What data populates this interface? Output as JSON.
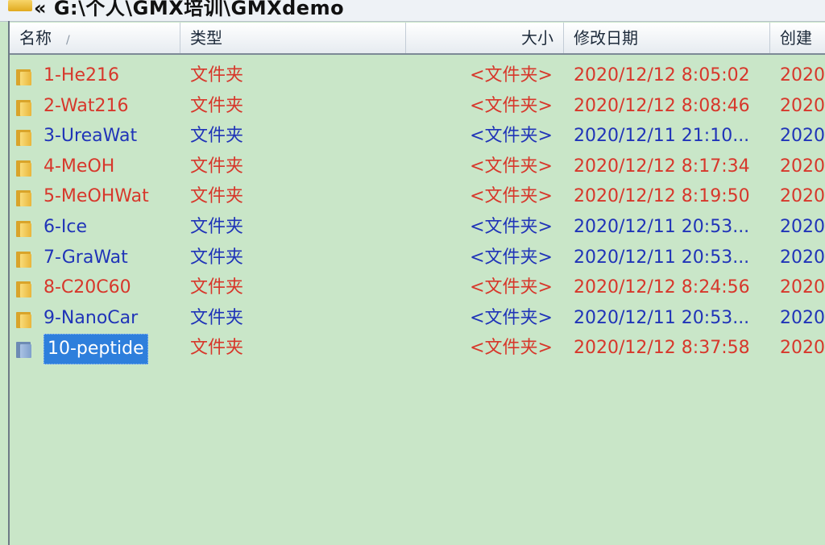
{
  "address_bar": {
    "path": "« G:\\个人\\GMX培训\\GMXdemo"
  },
  "columns": [
    {
      "label": "名称",
      "sort_indicator": "/"
    },
    {
      "label": "类型"
    },
    {
      "label": "大小"
    },
    {
      "label": "修改日期"
    },
    {
      "label": "创建"
    }
  ],
  "rows": [
    {
      "name": "1-He216",
      "type": "文件夹",
      "size": "<文件夹>",
      "modified": "2020/12/12 8:05:02",
      "created": "2020",
      "color": "#d7372b",
      "selected": false
    },
    {
      "name": "2-Wat216",
      "type": "文件夹",
      "size": "<文件夹>",
      "modified": "2020/12/12 8:08:46",
      "created": "2020",
      "color": "#d7372b",
      "selected": false
    },
    {
      "name": "3-UreaWat",
      "type": "文件夹",
      "size": "<文件夹>",
      "modified": "2020/12/11 21:10...",
      "created": "2020",
      "color": "#2034b8",
      "selected": false
    },
    {
      "name": "4-MeOH",
      "type": "文件夹",
      "size": "<文件夹>",
      "modified": "2020/12/12 8:17:34",
      "created": "2020",
      "color": "#d7372b",
      "selected": false
    },
    {
      "name": "5-MeOHWat",
      "type": "文件夹",
      "size": "<文件夹>",
      "modified": "2020/12/12 8:19:50",
      "created": "2020",
      "color": "#d7372b",
      "selected": false
    },
    {
      "name": "6-Ice",
      "type": "文件夹",
      "size": "<文件夹>",
      "modified": "2020/12/11 20:53...",
      "created": "2020",
      "color": "#2034b8",
      "selected": false
    },
    {
      "name": "7-GraWat",
      "type": "文件夹",
      "size": "<文件夹>",
      "modified": "2020/12/11 20:53...",
      "created": "2020",
      "color": "#2034b8",
      "selected": false
    },
    {
      "name": "8-C20C60",
      "type": "文件夹",
      "size": "<文件夹>",
      "modified": "2020/12/12 8:24:56",
      "created": "2020",
      "color": "#d7372b",
      "selected": false
    },
    {
      "name": "9-NanoCar",
      "type": "文件夹",
      "size": "<文件夹>",
      "modified": "2020/12/11 20:53...",
      "created": "2020",
      "color": "#2034b8",
      "selected": false
    },
    {
      "name": "10-peptide",
      "type": "文件夹",
      "size": "<文件夹>",
      "modified": "2020/12/12 8:37:58",
      "created": "2020",
      "color": "#d7372b",
      "selected": true
    }
  ],
  "colors": {
    "background": "#c9e6c8",
    "selection": "#2e7fdc",
    "recent": "#d7372b",
    "older": "#2034b8"
  }
}
